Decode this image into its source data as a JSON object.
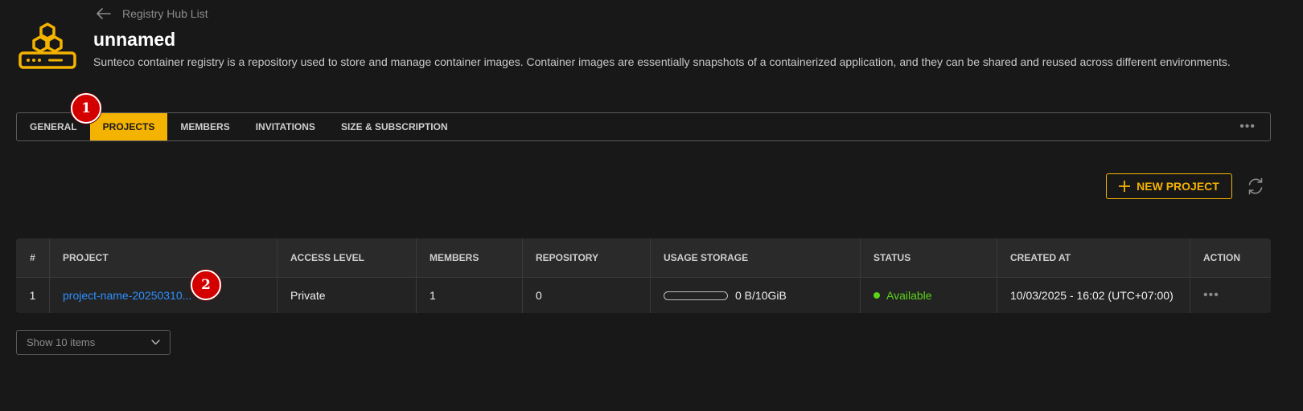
{
  "header": {
    "back_label": "Registry Hub List",
    "title": "unnamed",
    "description": "Sunteco container registry is a repository used to store and manage container images. Container images are essentially snapshots of a containerized application, and they can be shared and reused across different environments."
  },
  "tabs": [
    {
      "label": "GENERAL",
      "active": false
    },
    {
      "label": "PROJECTS",
      "active": true
    },
    {
      "label": "MEMBERS",
      "active": false
    },
    {
      "label": "INVITATIONS",
      "active": false
    },
    {
      "label": "SIZE & SUBSCRIPTION",
      "active": false
    }
  ],
  "tabs_more": "•••",
  "badges": {
    "one": "1",
    "two": "2"
  },
  "toolbar": {
    "new_project_label": "NEW PROJECT"
  },
  "table": {
    "columns": [
      "#",
      "PROJECT",
      "ACCESS LEVEL",
      "MEMBERS",
      "REPOSITORY",
      "USAGE STORAGE",
      "STATUS",
      "CREATED AT",
      "ACTION"
    ],
    "rows": [
      {
        "index": "1",
        "project": "project-name-20250310...",
        "access_level": "Private",
        "members": "1",
        "repository": "0",
        "usage_storage": "0 B/10GiB",
        "usage_fraction": 0,
        "status": "Available",
        "created_at": "10/03/2025 - 16:02 (UTC+07:00)",
        "action": "•••"
      }
    ]
  },
  "pagination": {
    "page_size_label": "Show 10 items"
  },
  "colors": {
    "accent": "#f5b301",
    "link": "#2f8fff",
    "status_available": "#5bd318",
    "badge": "#d40000"
  }
}
